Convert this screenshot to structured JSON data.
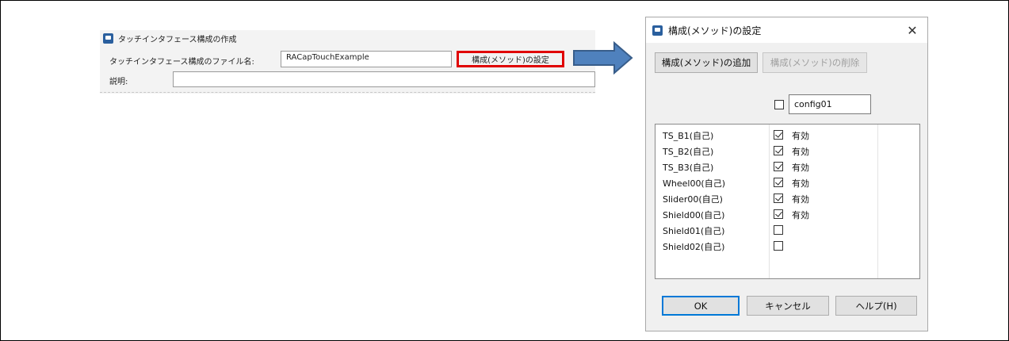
{
  "left_panel": {
    "title": "タッチインタフェース構成の作成",
    "filename_label": "タッチインタフェース構成のファイル名:",
    "filename_value": "RACapTouchExample",
    "settings_button": "構成(メソッド)の設定",
    "description_label": "説明:",
    "description_value": ""
  },
  "dialog": {
    "title": "構成(メソッド)の設定",
    "add_button": "構成(メソッド)の追加",
    "delete_button": "構成(メソッド)の削除",
    "config_checked": false,
    "config_name": "config01",
    "rows": [
      {
        "name": "TS_B1(自己)",
        "checked": true,
        "status": "有効"
      },
      {
        "name": "TS_B2(自己)",
        "checked": true,
        "status": "有効"
      },
      {
        "name": "TS_B3(自己)",
        "checked": true,
        "status": "有効"
      },
      {
        "name": "Wheel00(自己)",
        "checked": true,
        "status": "有効"
      },
      {
        "name": "Slider00(自己)",
        "checked": true,
        "status": "有効"
      },
      {
        "name": "Shield00(自己)",
        "checked": true,
        "status": "有効"
      },
      {
        "name": "Shield01(自己)",
        "checked": false,
        "status": ""
      },
      {
        "name": "Shield02(自己)",
        "checked": false,
        "status": ""
      }
    ],
    "ok_button": "OK",
    "cancel_button": "キャンセル",
    "help_button": "ヘルプ(H)"
  },
  "colors": {
    "highlight_border": "#e00000",
    "arrow_fill": "#4f81bd",
    "arrow_stroke": "#385d8a",
    "default_button_border": "#0078d7"
  }
}
